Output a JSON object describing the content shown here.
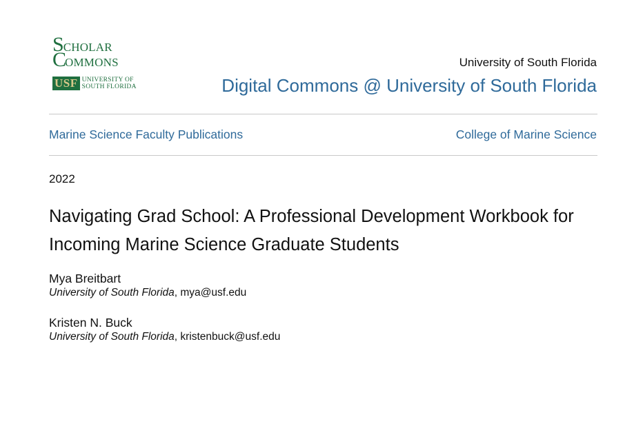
{
  "logo": {
    "scholar_first": "S",
    "scholar_rest": "CHOLAR",
    "commons_first": "C",
    "commons_rest": "OMMONS",
    "usf_mark": "USF",
    "usf_line1": "UNIVERSITY OF",
    "usf_line2": "SOUTH FLORIDA",
    "color": "#1f6f3f"
  },
  "header": {
    "university": "University of South Florida",
    "repository": "Digital Commons @ University of South Florida"
  },
  "nav": {
    "collection": "Marine Science Faculty Publications",
    "college": "College of Marine Science"
  },
  "document": {
    "year": "2022",
    "title": "Navigating Grad School: A Professional Development Workbook for Incoming Marine Science Graduate Students"
  },
  "authors": [
    {
      "name": "Mya Breitbart",
      "affiliation": "University of South Florida",
      "email": ", mya@usf.edu"
    },
    {
      "name": "Kristen N. Buck",
      "affiliation": "University of South Florida",
      "email": ", kristenbuck@usf.edu"
    }
  ],
  "colors": {
    "link": "#2f6a9a",
    "text": "#111111",
    "rule": "#c8c8c8"
  }
}
